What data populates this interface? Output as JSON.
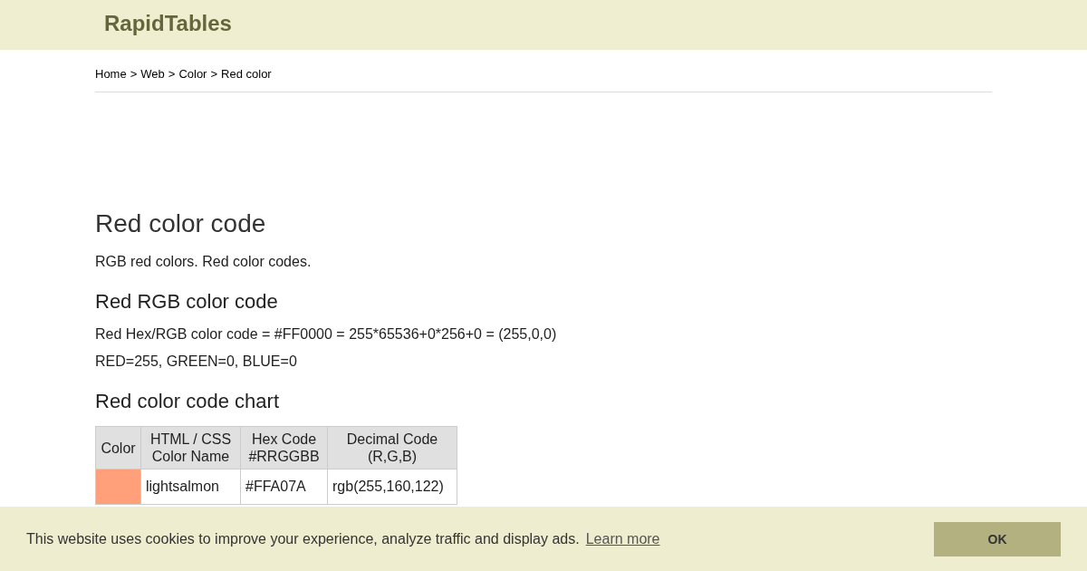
{
  "header": {
    "logo": "RapidTables"
  },
  "breadcrumb": {
    "separator": ">",
    "links": [
      "Home",
      "Web",
      "Color"
    ],
    "current": "Red color"
  },
  "title": "Red color code",
  "intro": "RGB red colors. Red color codes.",
  "sections": [
    {
      "heading": "Red RGB color code",
      "lines": [
        "Red Hex/RGB color code = #FF0000 = 255*65536+0*256+0 = (255,0,0)",
        "RED=255, GREEN=0, BLUE=0"
      ]
    },
    {
      "heading": "Red color code chart"
    }
  ],
  "table": {
    "columns": [
      "Color",
      "HTML / CSS Color Name",
      "Hex Code #RRGGBB",
      "Decimal Code (R,G,B)"
    ],
    "rows": [
      {
        "color": "#ffa07a",
        "name": "lightsalmon",
        "hex": "#FFA07A",
        "decimal": "rgb(255,160,122)"
      }
    ]
  },
  "cookie_bar": {
    "message": "This website uses cookies to improve your experience, analyze traffic and display ads.",
    "link": "Learn more",
    "button": "OK"
  }
}
